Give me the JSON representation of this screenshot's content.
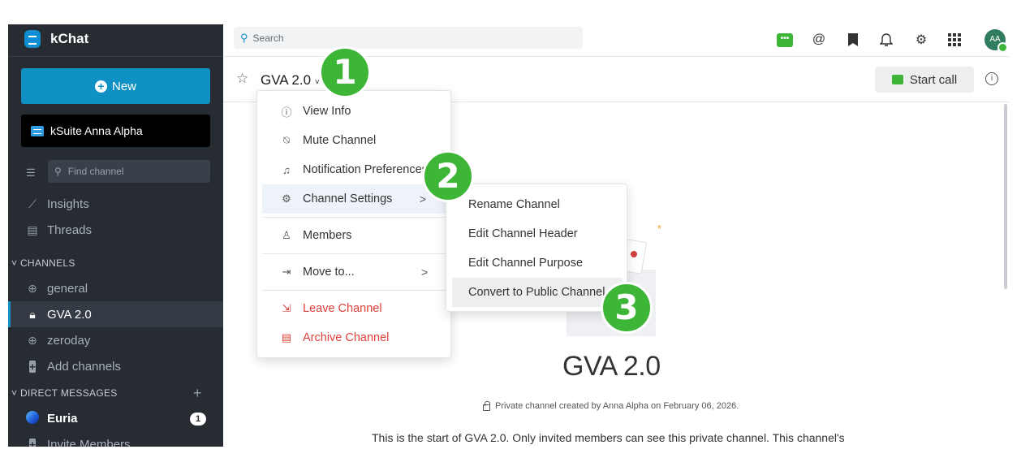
{
  "app": {
    "title": "kChat"
  },
  "sidebar": {
    "new_label": "New",
    "workspace_label": "kSuite Anna Alpha",
    "find_placeholder": "Find channel",
    "nav": [
      {
        "label": "Insights",
        "icon": "chart-icon"
      },
      {
        "label": "Threads",
        "icon": "threads-icon"
      }
    ],
    "channels_header": "CHANNELS",
    "channels": [
      {
        "label": "general",
        "icon": "globe-icon"
      },
      {
        "label": "GVA 2.0",
        "icon": "lock-icon",
        "active": true
      },
      {
        "label": "zeroday",
        "icon": "globe-icon"
      },
      {
        "label": "Add channels",
        "icon": "add-icon"
      }
    ],
    "dm_header": "DIRECT MESSAGES",
    "dm_add": "+",
    "dms": [
      {
        "label": "Euria",
        "badge": "1"
      },
      {
        "label": "Invite Members"
      }
    ]
  },
  "topbar": {
    "search_placeholder": "Search",
    "avatar_initials": "AA"
  },
  "channel": {
    "name": "GVA 2.0",
    "start_call_label": "Start call",
    "intro_title": "GVA 2.0",
    "private_line": "Private channel created by Anna Alpha on February 06, 2026.",
    "intro_text": "This is the start of GVA 2.0. Only invited members can see this private channel. This channel's"
  },
  "menu": {
    "items": [
      {
        "label": "View Info",
        "icon": "info-icon"
      },
      {
        "label": "Mute Channel",
        "icon": "bell-off-icon"
      },
      {
        "label": "Notification Preferences",
        "icon": "bell-icon"
      },
      {
        "label": "Channel Settings",
        "icon": "gear-icon",
        "arrow": ">"
      },
      {
        "label": "Members",
        "icon": "user-icon"
      },
      {
        "label": "Move to...",
        "icon": "move-icon",
        "arrow": ">"
      },
      {
        "label": "Leave Channel",
        "icon": "leave-icon"
      },
      {
        "label": "Archive Channel",
        "icon": "archive-icon"
      }
    ]
  },
  "submenu": {
    "items": [
      "Rename Channel",
      "Edit Channel Header",
      "Edit Channel Purpose",
      "Convert to Public Channel"
    ]
  },
  "steps": [
    "1",
    "2",
    "3"
  ],
  "colors": {
    "sidebar": "#272c33",
    "accent": "#0f91c4",
    "green": "#3db536",
    "danger": "#e0413a"
  }
}
